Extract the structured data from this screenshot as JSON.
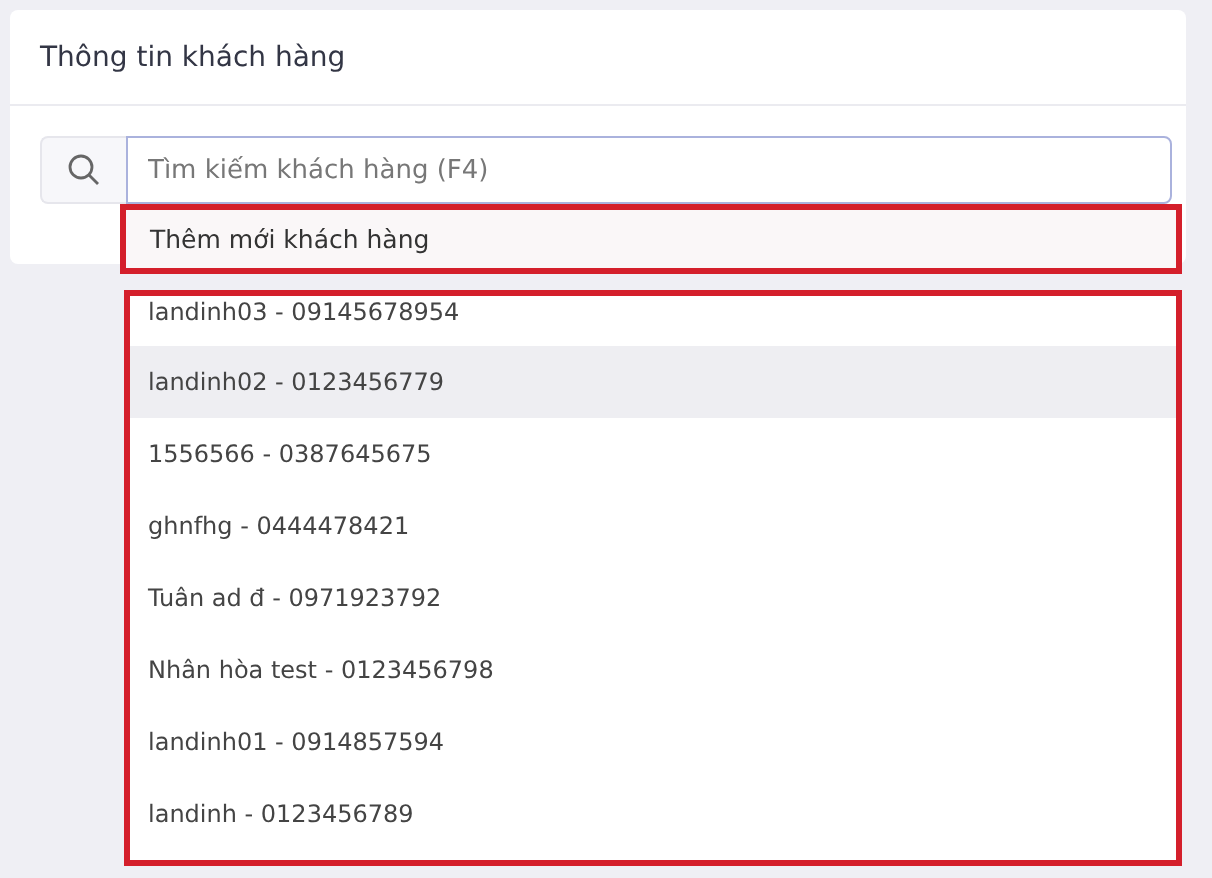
{
  "card": {
    "title": "Thông tin khách hàng"
  },
  "search": {
    "placeholder": "Tìm kiếm khách hàng (F4)"
  },
  "dropdown": {
    "add_option": {
      "label": "Thêm mới khách hàng",
      "outlined": true
    },
    "results_outlined": true,
    "results": [
      {
        "label": "landinh03 - 09145678954",
        "selected": false
      },
      {
        "label": "landinh02 - 0123456779",
        "selected": true
      },
      {
        "label": "1556566 - 0387645675",
        "selected": false
      },
      {
        "label": "ghnfhg - 0444478421",
        "selected": false
      },
      {
        "label": "Tuân ad đ - 0971923792",
        "selected": false
      },
      {
        "label": "Nhân hòa test - 0123456798",
        "selected": false
      },
      {
        "label": "landinh01 - 0914857594",
        "selected": false
      },
      {
        "label": "landinh - 0123456789",
        "selected": false
      }
    ]
  }
}
